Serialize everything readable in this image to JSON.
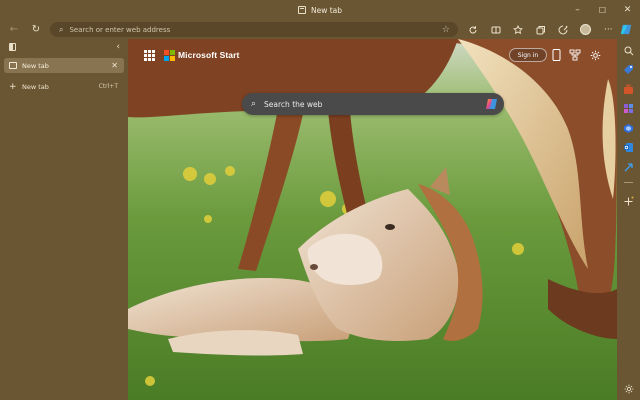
{
  "window": {
    "title": "New tab",
    "controls": {
      "minimize": "–",
      "maximize": "☐",
      "close": "✕"
    }
  },
  "toolbar": {
    "back": "←",
    "refresh": "↻",
    "address_placeholder": "Search or enter web address",
    "favorite": "☆",
    "icons": [
      "refresh-icon",
      "split-screen-icon",
      "favorites-icon",
      "collections-icon",
      "browser-essentials-icon",
      "profile-avatar",
      "more-icon"
    ],
    "more": "···"
  },
  "sidepane": {
    "tabs": [
      {
        "label": "New tab",
        "active": true,
        "close": "✕"
      }
    ],
    "new_tab": {
      "label": "New tab",
      "shortcut": "Ctrl+T",
      "plus": "+"
    },
    "collapse": "‹"
  },
  "ntp": {
    "brand": "Microsoft Start",
    "sign_in": "Sign in",
    "search_placeholder": "Search the web",
    "brand_colors": [
      "#f25022",
      "#7fba00",
      "#00a4ef",
      "#ffb900"
    ]
  },
  "rightbar": {
    "icons": [
      "search-icon",
      "shopping-tag-icon",
      "tools-briefcase-icon",
      "games-icon",
      "copilot-icon",
      "outlook-icon",
      "drop-icon",
      "add-icon",
      "settings-icon"
    ]
  }
}
